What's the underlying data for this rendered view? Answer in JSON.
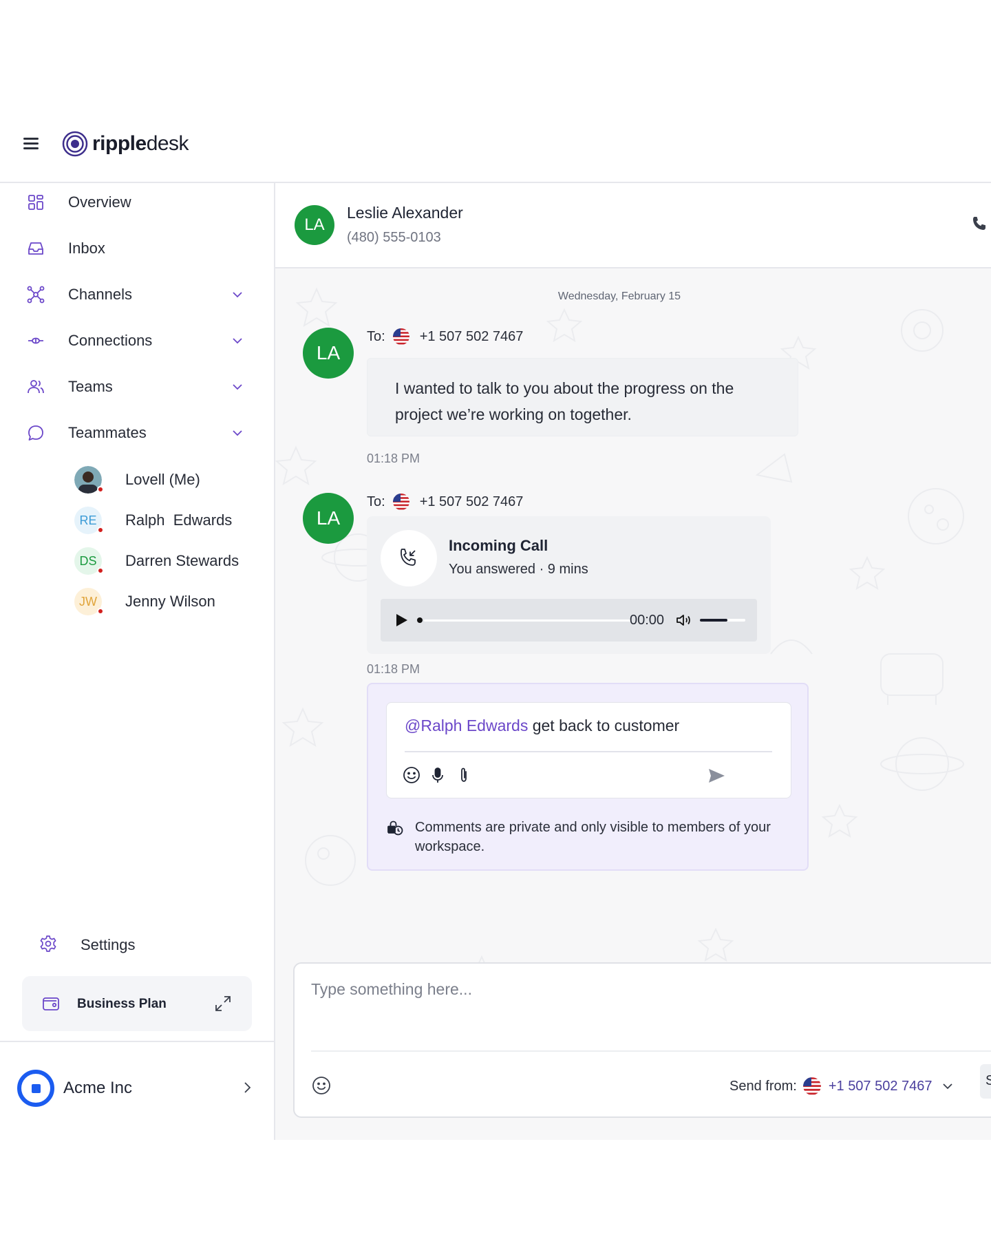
{
  "app": {
    "logo_strong": "ripple",
    "logo_light": "desk"
  },
  "sidebar": {
    "items": [
      {
        "label": "Overview",
        "icon": "grid-icon"
      },
      {
        "label": "Inbox",
        "icon": "inbox-icon"
      },
      {
        "label": "Channels",
        "icon": "network-icon",
        "expandable": true
      },
      {
        "label": "Connections",
        "icon": "connection-icon",
        "expandable": true
      },
      {
        "label": "Teams",
        "icon": "users-icon",
        "expandable": true
      },
      {
        "label": "Teammates",
        "icon": "chat-bubble-icon",
        "expandable": true
      }
    ],
    "teammates": [
      {
        "name": "Lovell (Me)",
        "initials": "",
        "status": "busy"
      },
      {
        "name": "Ralph  Edwards",
        "initials": "RE",
        "bg": "#e6f3fb",
        "fg": "#3b9bd6",
        "status": "busy"
      },
      {
        "name": "Darren Stewards",
        "initials": "DS",
        "bg": "#e4f6ea",
        "fg": "#1b9a3f",
        "status": "busy"
      },
      {
        "name": "Jenny Wilson",
        "initials": "JW",
        "bg": "#fdf0d8",
        "fg": "#e0a43a",
        "status": "busy"
      }
    ],
    "settings_label": "Settings",
    "plan_label": "Business Plan",
    "org_name": "Acme Inc"
  },
  "contact": {
    "initials": "LA",
    "name": "Leslie Alexander",
    "phone": "(480) 555-0103"
  },
  "chat": {
    "date_separator": "Wednesday, February 15",
    "messages": [
      {
        "to_label": "To:",
        "to_number": "+1 507 502 7467",
        "text": "I wanted to talk to you about the progress on the project we’re working on together.",
        "time": "01:18 PM"
      },
      {
        "to_label": "To:",
        "to_number": "+1 507 502 7467",
        "call_title": "Incoming Call",
        "call_sub": "You answered · 9 mins",
        "player_time": "00:00",
        "progress": 0.0,
        "volume": 0.6,
        "time": "01:18 PM"
      }
    ],
    "comment": {
      "mention": "@Ralph Edwards",
      "text": " get back to customer",
      "note": "Comments are private and only visible to members of your workspace."
    }
  },
  "composer": {
    "placeholder": "Type something here...",
    "send_from_label": "Send from:",
    "send_from_number": "+1 507 502 7467",
    "send_button_partial": "S"
  },
  "colors": {
    "accent": "#6b47c9",
    "avatar_green": "#1b9a3f",
    "status_red": "#d2201e",
    "org_blue": "#1b5cf0"
  }
}
